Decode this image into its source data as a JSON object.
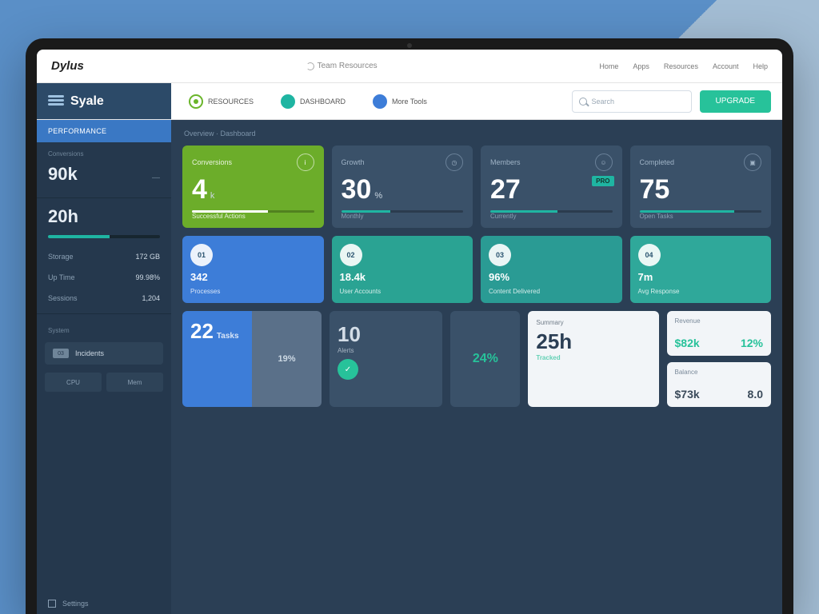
{
  "topbar": {
    "logo": "Dylus",
    "center": "Team Resources",
    "links": [
      "Home",
      "Apps",
      "Resources",
      "Account",
      "Help"
    ]
  },
  "subbar": {
    "brand": "Syale",
    "chip1": "RESOURCES",
    "chip2": "DASHBOARD",
    "chip3": "More Tools",
    "search_placeholder": "Search",
    "cta": "UPGRADE"
  },
  "sidebar": {
    "active": "PERFORMANCE",
    "section": "Conversions",
    "stat1": "90k",
    "stat1_side": "—",
    "stat2": "20h",
    "rows": [
      {
        "k": "Storage",
        "v": "172 GB"
      },
      {
        "k": "Up Time",
        "v": "99.98%"
      },
      {
        "k": "Sessions",
        "v": "1,204"
      }
    ],
    "sec2": "System",
    "pill_badge": "03",
    "pill_label": "Incidents",
    "mini1": "CPU",
    "mini2": "Mem",
    "foot": "Settings"
  },
  "main": {
    "crumb": "Overview · Dashboard",
    "tiles": [
      {
        "label": "Conversions",
        "num": "4",
        "suffix": "k",
        "cap": "Successful Actions",
        "bar": 62
      },
      {
        "label": "Growth",
        "num": "30",
        "suffix": "%",
        "cap": "Monthly",
        "bar": 40
      },
      {
        "label": "Members",
        "num": "27",
        "suffix": "",
        "cap": "Currently",
        "tag": "PRO",
        "bar": 55
      },
      {
        "label": "Completed",
        "num": "75",
        "suffix": "",
        "cap": "Open Tasks",
        "bar": 78
      }
    ],
    "small": [
      {
        "circ": "01",
        "val": "342",
        "sub": "Processes",
        "cls": "bg-blue"
      },
      {
        "circ": "02",
        "val": "18.4k",
        "sub": "User Accounts",
        "cls": "bg-teal"
      },
      {
        "circ": "03",
        "val": "96%",
        "sub": "Content Delivered",
        "cls": "bg-teal2"
      },
      {
        "circ": "04",
        "val": "7m",
        "sub": "Avg Response",
        "cls": "bg-teal3"
      }
    ],
    "row3": {
      "a_num": "22",
      "a_sub": "Tasks",
      "a_side": "19%",
      "b_num": "10",
      "b_sub": "Alerts",
      "c_val": "24%",
      "d_h": "Summary",
      "d_big": "25h",
      "d_sub": "Tracked",
      "e1_h": "Revenue",
      "e1_a": "$82k",
      "e1_b": "12%",
      "e2_h": "Balance",
      "e2_a": "$73k",
      "e2_b": "8.0"
    }
  }
}
